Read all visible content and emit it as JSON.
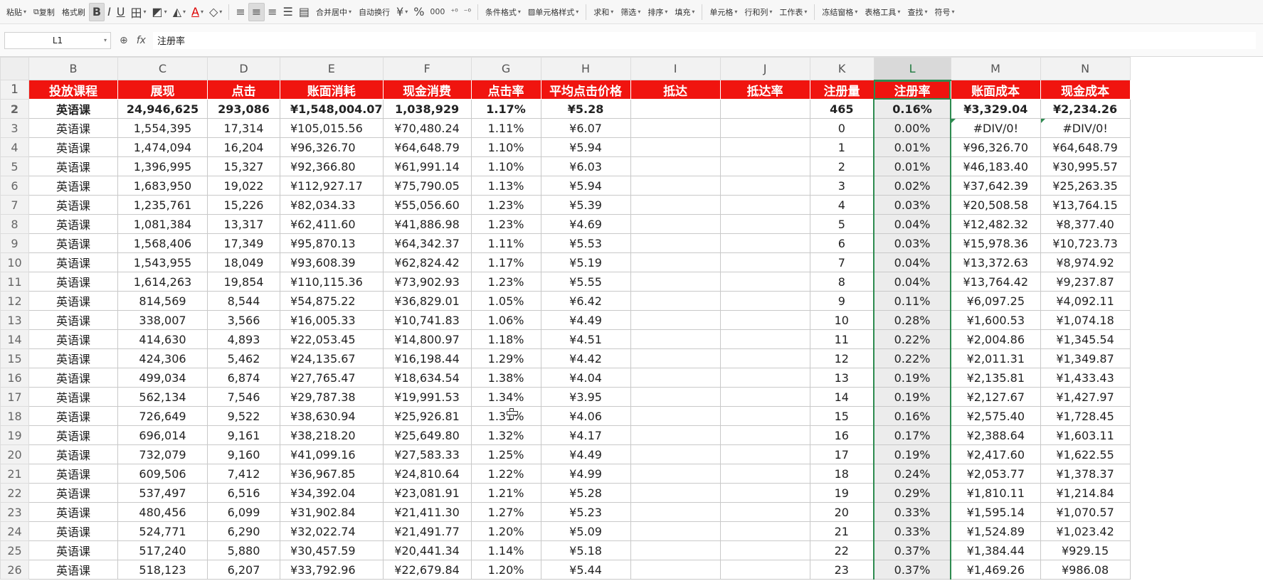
{
  "toolbar": {
    "items": [
      {
        "label": "粘贴",
        "icon": "paste-icon"
      },
      {
        "label": "复制",
        "icon": "copy-icon"
      },
      {
        "label": "格式刷",
        "icon": "format-painter-icon"
      },
      {
        "label": "合并居中"
      },
      {
        "label": "自动换行"
      },
      {
        "label": "条件格式"
      },
      {
        "label": "单元格样式"
      },
      {
        "label": "求和"
      },
      {
        "label": "筛选"
      },
      {
        "label": "排序"
      },
      {
        "label": "填充"
      },
      {
        "label": "单元格"
      },
      {
        "label": "行和列"
      },
      {
        "label": "工作表"
      },
      {
        "label": "冻结窗格"
      },
      {
        "label": "表格工具"
      },
      {
        "label": "查找"
      },
      {
        "label": "符号"
      }
    ]
  },
  "formula_bar": {
    "name_box": "L1",
    "zoom_icon": "zoom-icon",
    "fx_icon": "fx-icon",
    "content": "注册率"
  },
  "grid": {
    "columns": [
      "B",
      "C",
      "D",
      "E",
      "F",
      "G",
      "H",
      "I",
      "J",
      "K",
      "L",
      "M",
      "N"
    ],
    "selected_column": "L",
    "header_row": [
      "投放课程",
      "展现",
      "点击",
      "账面消耗",
      "现金消费",
      "点击率",
      "平均点击价格",
      "抵达",
      "抵达率",
      "注册量",
      "注册率",
      "账面成本",
      "现金成本"
    ],
    "rows": [
      {
        "num": "2",
        "total": true,
        "cells": [
          "英语课",
          "24,946,625",
          "293,086",
          "¥1,548,004.07",
          "1,038,929",
          "1.17%",
          "¥5.28",
          "",
          "",
          "465",
          "0.16%",
          "¥3,329.04",
          "¥2,234.26"
        ]
      },
      {
        "num": "3",
        "cells": [
          "英语课",
          "1,554,395",
          "17,314",
          "¥105,015.56",
          "¥70,480.24",
          "1.11%",
          "¥6.07",
          "",
          "",
          "0",
          "0.00%",
          "#DIV/0!",
          "#DIV/0!"
        ]
      },
      {
        "num": "4",
        "cells": [
          "英语课",
          "1,474,094",
          "16,204",
          "¥96,326.70",
          "¥64,648.79",
          "1.10%",
          "¥5.94",
          "",
          "",
          "1",
          "0.01%",
          "¥96,326.70",
          "¥64,648.79"
        ]
      },
      {
        "num": "5",
        "cells": [
          "英语课",
          "1,396,995",
          "15,327",
          "¥92,366.80",
          "¥61,991.14",
          "1.10%",
          "¥6.03",
          "",
          "",
          "2",
          "0.01%",
          "¥46,183.40",
          "¥30,995.57"
        ]
      },
      {
        "num": "6",
        "cells": [
          "英语课",
          "1,683,950",
          "19,022",
          "¥112,927.17",
          "¥75,790.05",
          "1.13%",
          "¥5.94",
          "",
          "",
          "3",
          "0.02%",
          "¥37,642.39",
          "¥25,263.35"
        ]
      },
      {
        "num": "7",
        "cells": [
          "英语课",
          "1,235,761",
          "15,226",
          "¥82,034.33",
          "¥55,056.60",
          "1.23%",
          "¥5.39",
          "",
          "",
          "4",
          "0.03%",
          "¥20,508.58",
          "¥13,764.15"
        ]
      },
      {
        "num": "8",
        "cells": [
          "英语课",
          "1,081,384",
          "13,317",
          "¥62,411.60",
          "¥41,886.98",
          "1.23%",
          "¥4.69",
          "",
          "",
          "5",
          "0.04%",
          "¥12,482.32",
          "¥8,377.40"
        ]
      },
      {
        "num": "9",
        "cells": [
          "英语课",
          "1,568,406",
          "17,349",
          "¥95,870.13",
          "¥64,342.37",
          "1.11%",
          "¥5.53",
          "",
          "",
          "6",
          "0.03%",
          "¥15,978.36",
          "¥10,723.73"
        ]
      },
      {
        "num": "10",
        "cells": [
          "英语课",
          "1,543,955",
          "18,049",
          "¥93,608.39",
          "¥62,824.42",
          "1.17%",
          "¥5.19",
          "",
          "",
          "7",
          "0.04%",
          "¥13,372.63",
          "¥8,974.92"
        ]
      },
      {
        "num": "11",
        "cells": [
          "英语课",
          "1,614,263",
          "19,854",
          "¥110,115.36",
          "¥73,902.93",
          "1.23%",
          "¥5.55",
          "",
          "",
          "8",
          "0.04%",
          "¥13,764.42",
          "¥9,237.87"
        ]
      },
      {
        "num": "12",
        "cells": [
          "英语课",
          "814,569",
          "8,544",
          "¥54,875.22",
          "¥36,829.01",
          "1.05%",
          "¥6.42",
          "",
          "",
          "9",
          "0.11%",
          "¥6,097.25",
          "¥4,092.11"
        ]
      },
      {
        "num": "13",
        "cells": [
          "英语课",
          "338,007",
          "3,566",
          "¥16,005.33",
          "¥10,741.83",
          "1.06%",
          "¥4.49",
          "",
          "",
          "10",
          "0.28%",
          "¥1,600.53",
          "¥1,074.18"
        ]
      },
      {
        "num": "14",
        "cells": [
          "英语课",
          "414,630",
          "4,893",
          "¥22,053.45",
          "¥14,800.97",
          "1.18%",
          "¥4.51",
          "",
          "",
          "11",
          "0.22%",
          "¥2,004.86",
          "¥1,345.54"
        ]
      },
      {
        "num": "15",
        "cells": [
          "英语课",
          "424,306",
          "5,462",
          "¥24,135.67",
          "¥16,198.44",
          "1.29%",
          "¥4.42",
          "",
          "",
          "12",
          "0.22%",
          "¥2,011.31",
          "¥1,349.87"
        ]
      },
      {
        "num": "16",
        "cells": [
          "英语课",
          "499,034",
          "6,874",
          "¥27,765.47",
          "¥18,634.54",
          "1.38%",
          "¥4.04",
          "",
          "",
          "13",
          "0.19%",
          "¥2,135.81",
          "¥1,433.43"
        ]
      },
      {
        "num": "17",
        "cells": [
          "英语课",
          "562,134",
          "7,546",
          "¥29,787.38",
          "¥19,991.53",
          "1.34%",
          "¥3.95",
          "",
          "",
          "14",
          "0.19%",
          "¥2,127.67",
          "¥1,427.97"
        ]
      },
      {
        "num": "18",
        "cells": [
          "英语课",
          "726,649",
          "9,522",
          "¥38,630.94",
          "¥25,926.81",
          "1.31%",
          "¥4.06",
          "",
          "",
          "15",
          "0.16%",
          "¥2,575.40",
          "¥1,728.45"
        ]
      },
      {
        "num": "19",
        "cells": [
          "英语课",
          "696,014",
          "9,161",
          "¥38,218.20",
          "¥25,649.80",
          "1.32%",
          "¥4.17",
          "",
          "",
          "16",
          "0.17%",
          "¥2,388.64",
          "¥1,603.11"
        ]
      },
      {
        "num": "20",
        "cells": [
          "英语课",
          "732,079",
          "9,160",
          "¥41,099.16",
          "¥27,583.33",
          "1.25%",
          "¥4.49",
          "",
          "",
          "17",
          "0.19%",
          "¥2,417.60",
          "¥1,622.55"
        ]
      },
      {
        "num": "21",
        "cells": [
          "英语课",
          "609,506",
          "7,412",
          "¥36,967.85",
          "¥24,810.64",
          "1.22%",
          "¥4.99",
          "",
          "",
          "18",
          "0.24%",
          "¥2,053.77",
          "¥1,378.37"
        ]
      },
      {
        "num": "22",
        "cells": [
          "英语课",
          "537,497",
          "6,516",
          "¥34,392.04",
          "¥23,081.91",
          "1.21%",
          "¥5.28",
          "",
          "",
          "19",
          "0.29%",
          "¥1,810.11",
          "¥1,214.84"
        ]
      },
      {
        "num": "23",
        "cells": [
          "英语课",
          "480,456",
          "6,099",
          "¥31,902.84",
          "¥21,411.30",
          "1.27%",
          "¥5.23",
          "",
          "",
          "20",
          "0.33%",
          "¥1,595.14",
          "¥1,070.57"
        ]
      },
      {
        "num": "24",
        "cells": [
          "英语课",
          "524,771",
          "6,290",
          "¥32,022.74",
          "¥21,491.77",
          "1.20%",
          "¥5.09",
          "",
          "",
          "21",
          "0.33%",
          "¥1,524.89",
          "¥1,023.42"
        ]
      },
      {
        "num": "25",
        "cells": [
          "英语课",
          "517,240",
          "5,880",
          "¥30,457.59",
          "¥20,441.34",
          "1.14%",
          "¥5.18",
          "",
          "",
          "22",
          "0.37%",
          "¥1,384.44",
          "¥929.15"
        ]
      },
      {
        "num": "26",
        "cells": [
          "英语课",
          "518,123",
          "6,207",
          "¥33,792.96",
          "¥22,679.84",
          "1.20%",
          "¥5.44",
          "",
          "",
          "23",
          "0.37%",
          "¥1,469.26",
          "¥986.08"
        ]
      }
    ]
  },
  "colors": {
    "header_bg": "#f0140f",
    "header_text": "#ffffff",
    "selection": "#2e8b50"
  }
}
